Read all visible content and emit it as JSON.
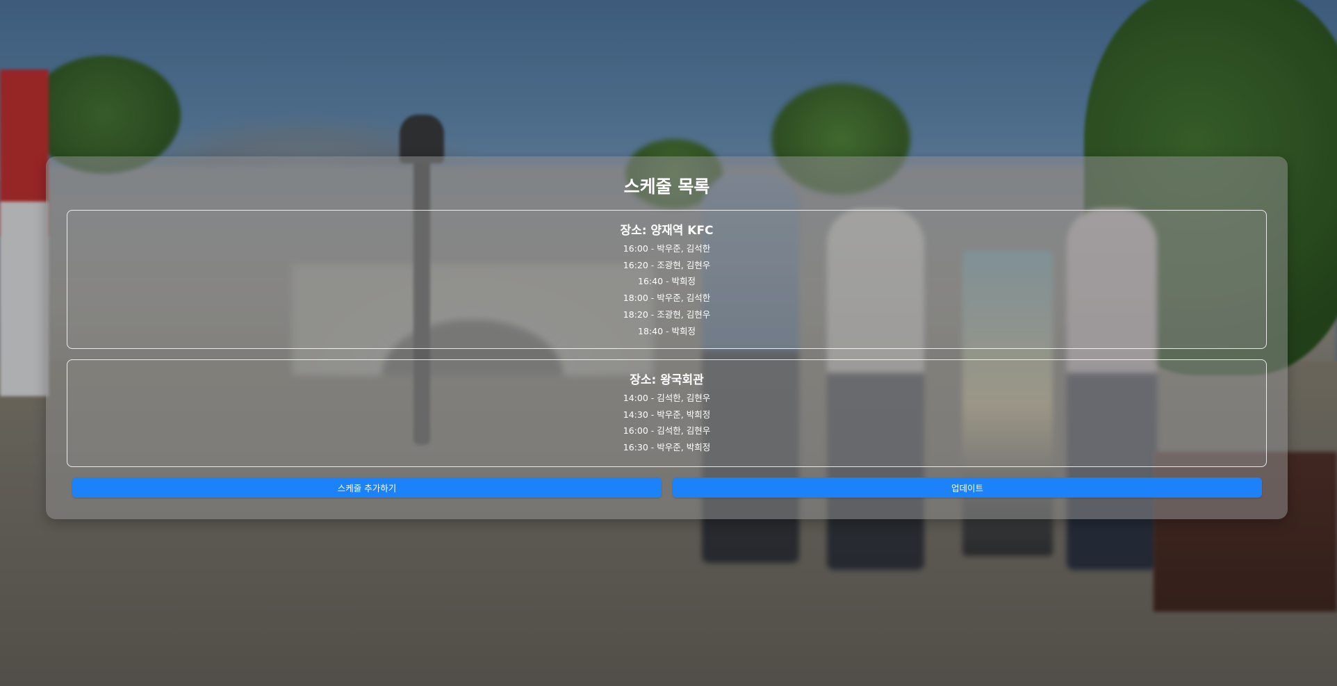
{
  "title": "스케줄 목록",
  "locations": [
    {
      "name": "장소: 양재역 KFC",
      "slots": [
        "16:00 - 박우준, 김석한",
        "16:20 - 조광현, 김현우",
        "16:40 - 박희정",
        "18:00 - 박우준, 김석한",
        "18:20 - 조광현, 김현우",
        "18:40 - 박희정"
      ]
    },
    {
      "name": "장소: 왕국회관",
      "slots": [
        "14:00 - 김석한, 김현우",
        "14:30 - 박우준, 박희정",
        "16:00 - 김석한, 김현우",
        "16:30 - 박우준, 박희정"
      ]
    }
  ],
  "buttons": {
    "add_label": "스케줄 추가하기",
    "update_label": "업데이트"
  },
  "colors": {
    "button": "#1c82fa",
    "text": "#ffffff"
  }
}
